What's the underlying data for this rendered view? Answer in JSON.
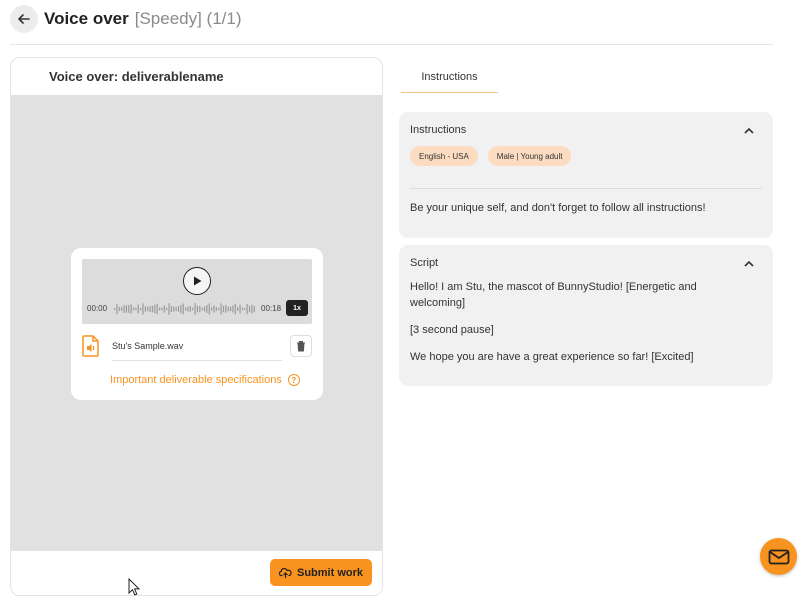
{
  "header": {
    "title": "Voice over",
    "subtitle": "[Speedy] (1/1)"
  },
  "left_panel": {
    "title": "Voice over: deliverablename",
    "player": {
      "current_time": "00:00",
      "duration": "00:18",
      "speed": "1x"
    },
    "file": {
      "name": "Stu's Sample.wav"
    },
    "spec_link": "Important deliverable specifications",
    "submit_label": "Submit work"
  },
  "tabs": {
    "active": "Instructions"
  },
  "instructions": {
    "title": "Instructions",
    "tags": [
      "English - USA",
      "Male | Young adult"
    ],
    "text": "Be your unique self, and don't forget to follow all instructions!"
  },
  "script": {
    "title": "Script",
    "lines": [
      "Hello! I am Stu, the mascot of BunnyStudio! [Energetic and welcoming]",
      "[3 second pause]",
      "We hope you are have a great experience so far! [Excited]"
    ]
  },
  "colors": {
    "accent": "#f7931e",
    "tag_bg": "#fcdcc0",
    "panel_bg": "#f1f1f2"
  }
}
